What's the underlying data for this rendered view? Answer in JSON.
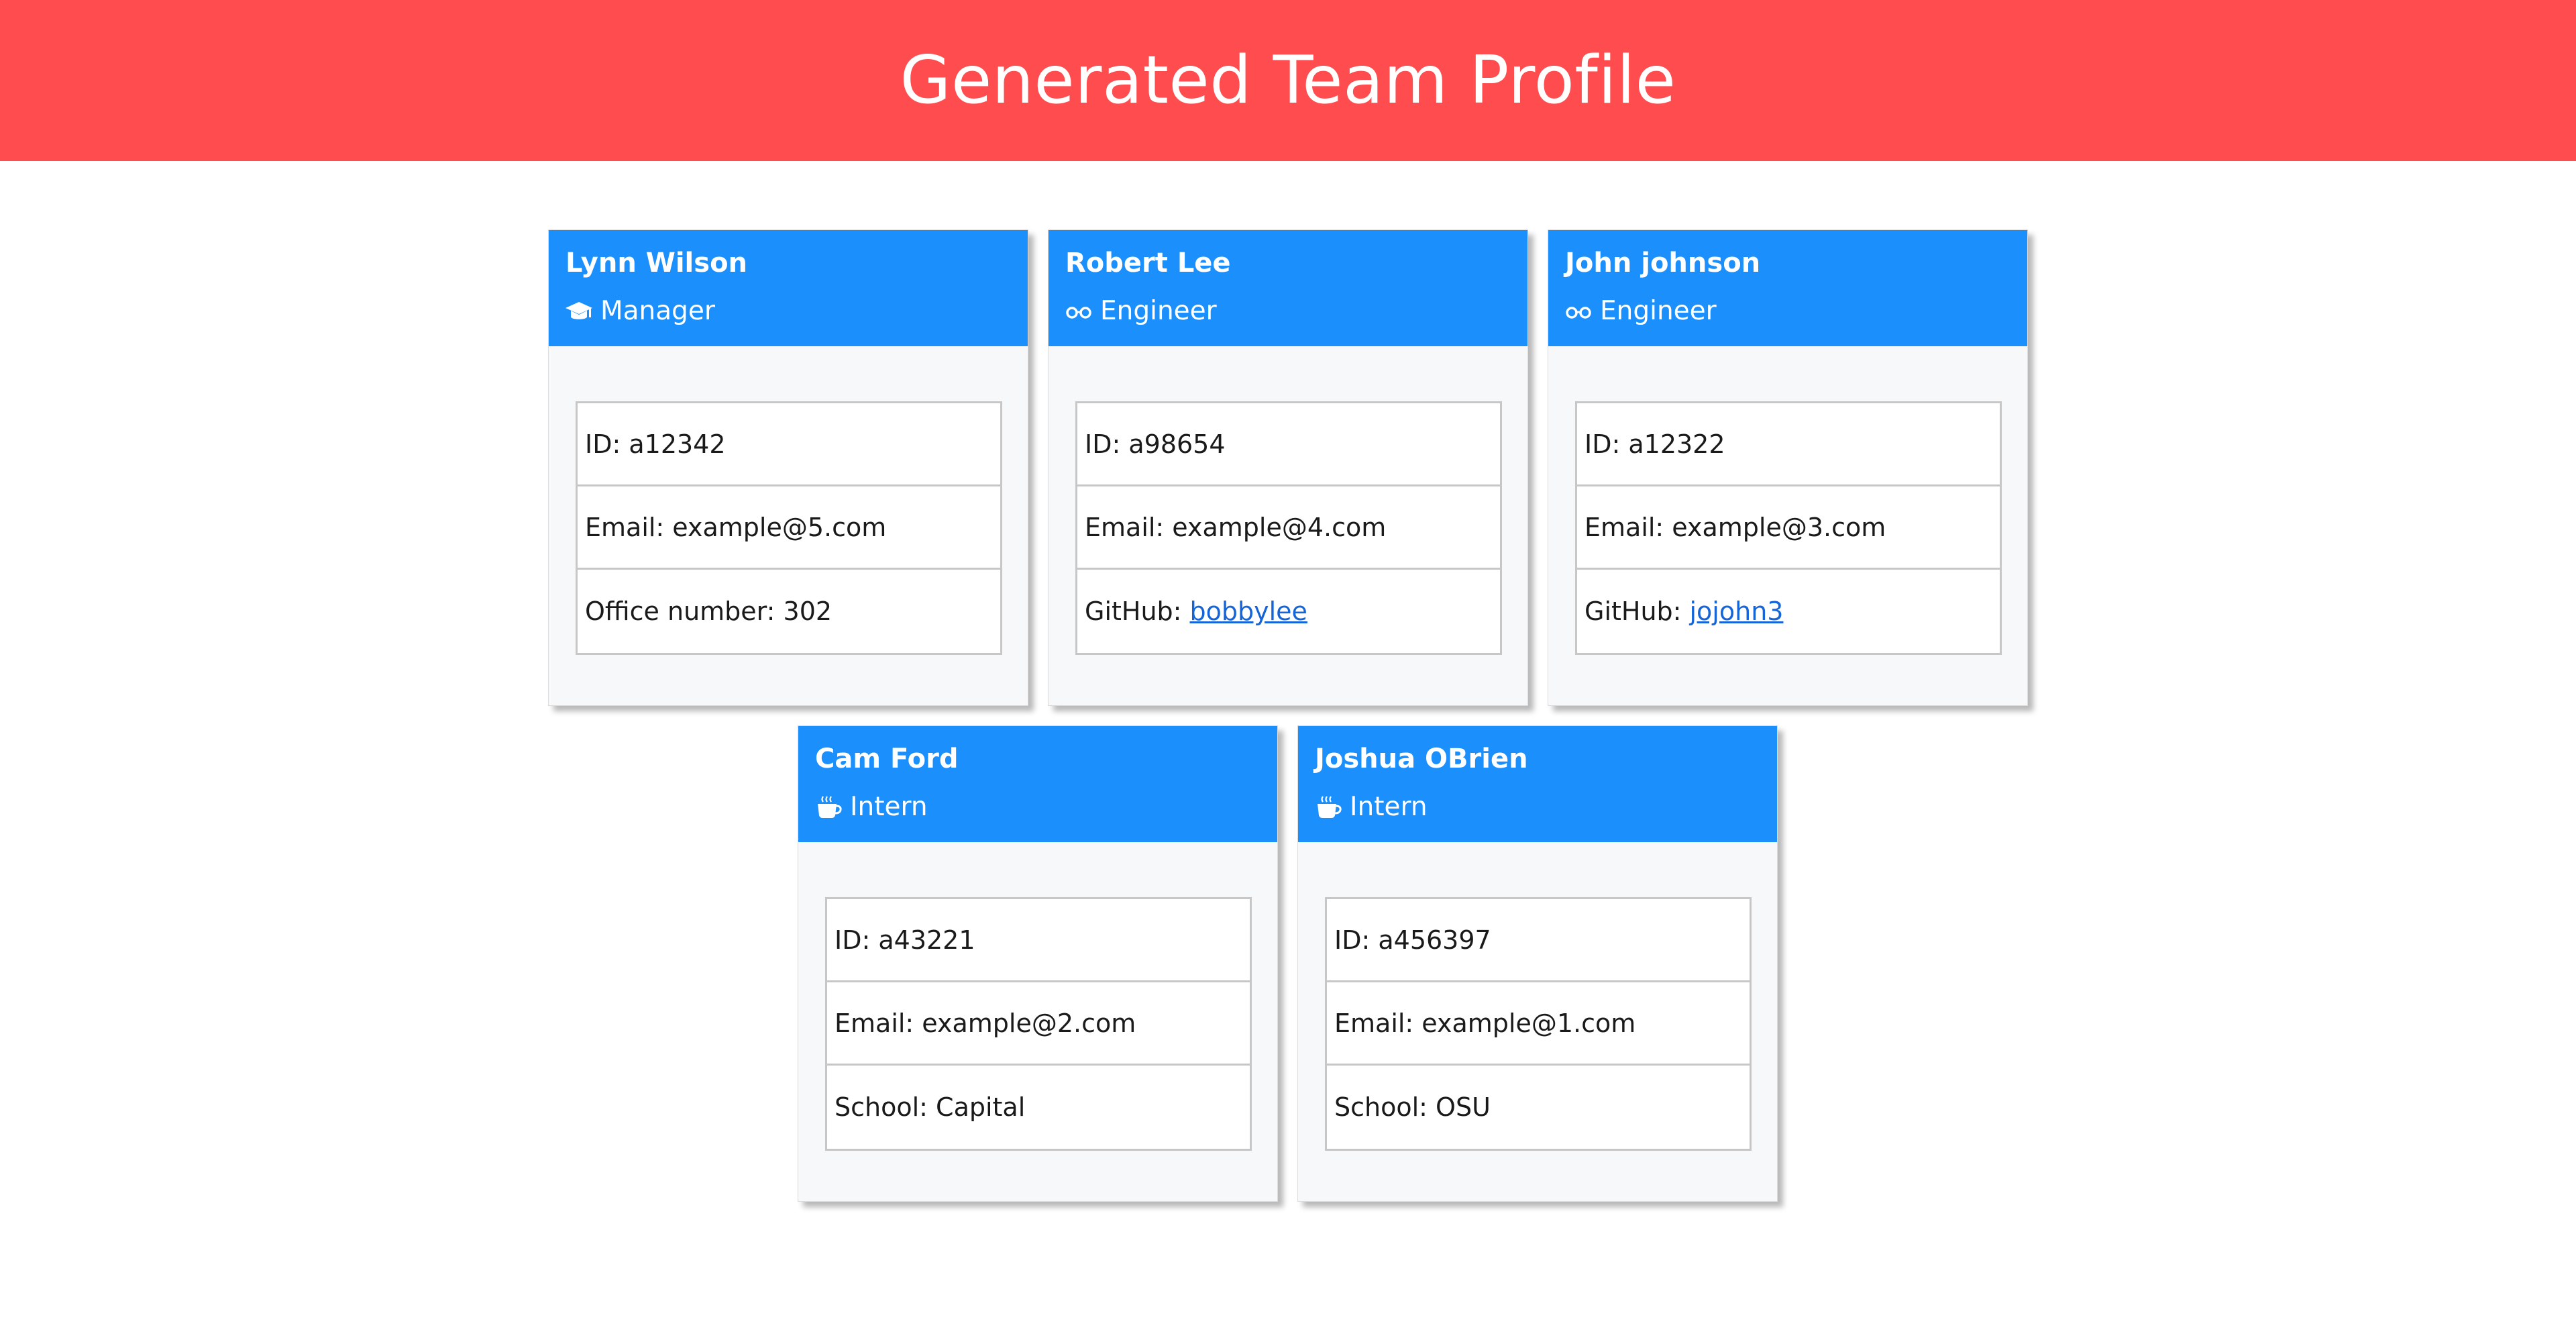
{
  "header": {
    "title": "Generated Team Profile"
  },
  "colors": {
    "banner": "#ff4c4e",
    "card_header": "#1b8ffc",
    "link": "#1565d8"
  },
  "team": [
    {
      "name": "Lynn Wilson",
      "role": "Manager",
      "icon": "graduation-cap-icon",
      "id_text": "ID: a12342",
      "email_text": "Email: example@5.com",
      "extra_label": "Office number: 302",
      "extra_link": ""
    },
    {
      "name": "Robert Lee",
      "role": "Engineer",
      "icon": "glasses-icon",
      "id_text": "ID: a98654",
      "email_text": "Email: example@4.com",
      "extra_label": "GitHub:",
      "extra_link": "bobbylee"
    },
    {
      "name": "John johnson",
      "role": "Engineer",
      "icon": "glasses-icon",
      "id_text": "ID: a12322",
      "email_text": "Email: example@3.com",
      "extra_label": "GitHub:",
      "extra_link": "jojohn3"
    },
    {
      "name": "Cam Ford",
      "role": "Intern",
      "icon": "coffee-mug-icon",
      "id_text": "ID: a43221",
      "email_text": "Email: example@2.com",
      "extra_label": "School: Capital",
      "extra_link": ""
    },
    {
      "name": "Joshua OBrien",
      "role": "Intern",
      "icon": "coffee-mug-icon",
      "id_text": "ID: a456397",
      "email_text": "Email: example@1.com",
      "extra_label": "School: OSU",
      "extra_link": ""
    }
  ]
}
